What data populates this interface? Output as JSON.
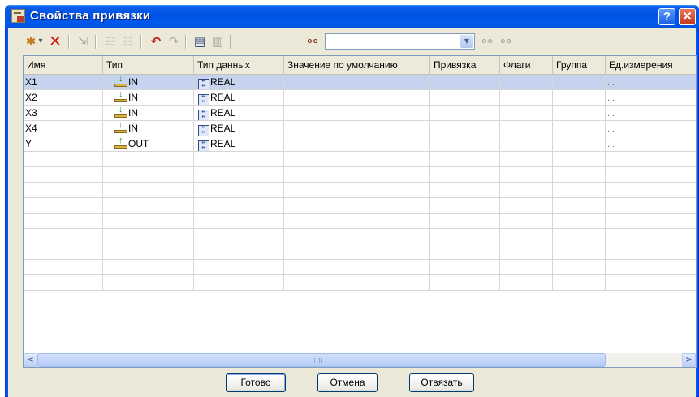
{
  "window": {
    "title": "Свойства привязки",
    "help_label": "?",
    "close_label": "✕"
  },
  "toolbar": {
    "add_icon": "✱",
    "dropdown_arrow": "▾",
    "delete_icon": "✕",
    "insert_icon": "⇲",
    "move_up_icon": "☷",
    "move_down_icon": "☷",
    "undo_icon": "↶",
    "redo_icon": "↷",
    "copy_icon": "▤",
    "paste_icon": "▥",
    "find_icon": "⚯",
    "search": {
      "value": "",
      "arrow": "▼"
    },
    "find_prev_icon": "⚯",
    "find_next_icon": "⚯"
  },
  "table": {
    "columns": [
      "Имя",
      "Тип",
      "Тип данных",
      "Значение по умолчанию",
      "Привязка",
      "Флаги",
      "Группа",
      "Ед.измерения"
    ],
    "rows": [
      {
        "name": "X1",
        "kind": "IN",
        "dtype": "REAL",
        "default": "",
        "binding": "",
        "flags": "",
        "group": "",
        "unit": "...",
        "selected": true
      },
      {
        "name": "X2",
        "kind": "IN",
        "dtype": "REAL",
        "default": "",
        "binding": "",
        "flags": "",
        "group": "",
        "unit": "...",
        "selected": false
      },
      {
        "name": "X3",
        "kind": "IN",
        "dtype": "REAL",
        "default": "",
        "binding": "",
        "flags": "",
        "group": "",
        "unit": "...",
        "selected": false
      },
      {
        "name": "X4",
        "kind": "IN",
        "dtype": "REAL",
        "default": "",
        "binding": "",
        "flags": "",
        "group": "",
        "unit": "...",
        "selected": false
      },
      {
        "name": "Y",
        "kind": "OUT",
        "dtype": "REAL",
        "default": "",
        "binding": "",
        "flags": "",
        "group": "",
        "unit": "...",
        "selected": false
      }
    ],
    "empty_rows": 9,
    "scroll_left": "<",
    "scroll_right": ">"
  },
  "buttons": {
    "done": "Готово",
    "cancel": "Отмена",
    "unbind": "Отвязать"
  },
  "colors": {
    "titlebar": "#0054e3",
    "selection": "#c6d3ee",
    "dialog_bg": "#ece9d8"
  }
}
